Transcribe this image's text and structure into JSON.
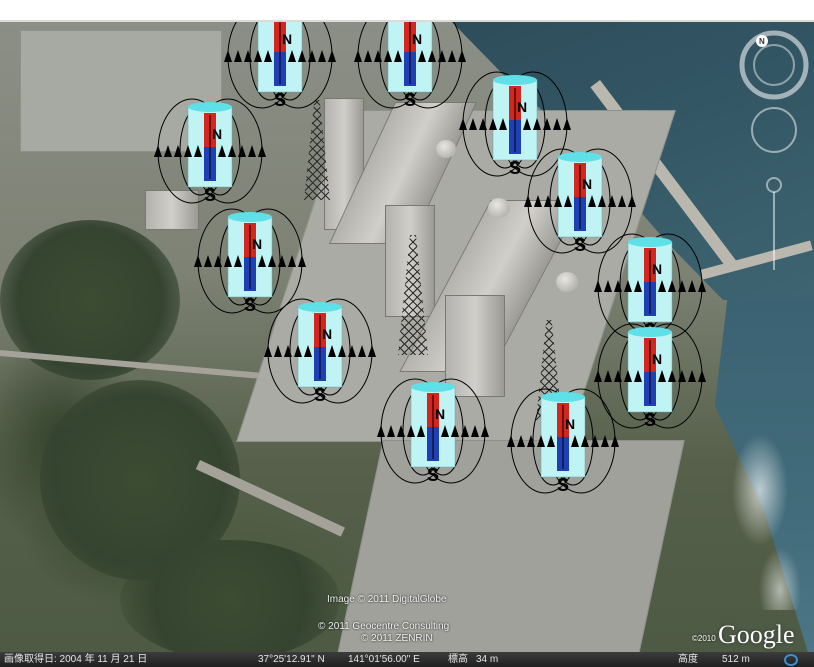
{
  "map": {
    "imagery_credit": "Image © 2011 DigitalGlobe",
    "credit_line_2": "© 2011 Geocentre Consulting",
    "credit_line_3": "© 2011 ZENRIN",
    "logo_text": "Google",
    "logo_year": "©2010"
  },
  "status": {
    "capture_date": "画像取得日: 2004 年 11 月 21 日",
    "latitude": "37°25'12.91\" N",
    "longitude": "141°01'56.00\" E",
    "elevation_label": "標高",
    "elevation_value": "34 m",
    "altitude_label": "高度",
    "altitude_value": "512 m"
  },
  "navigation": {
    "compass_north": "N"
  },
  "magnet_labels": {
    "north": "N",
    "south": "S"
  },
  "colors": {
    "magnet_north": "#d2261e",
    "magnet_south": "#1f3fb4",
    "cylinder": "#bff3f4",
    "cylinder_top": "#5fe0e6",
    "field_lines": "#000000"
  },
  "icons": [
    "compass-ring-icon",
    "look-joystick-icon",
    "zoom-slider-icon",
    "magnet-icon",
    "transmission-tower-icon"
  ]
}
